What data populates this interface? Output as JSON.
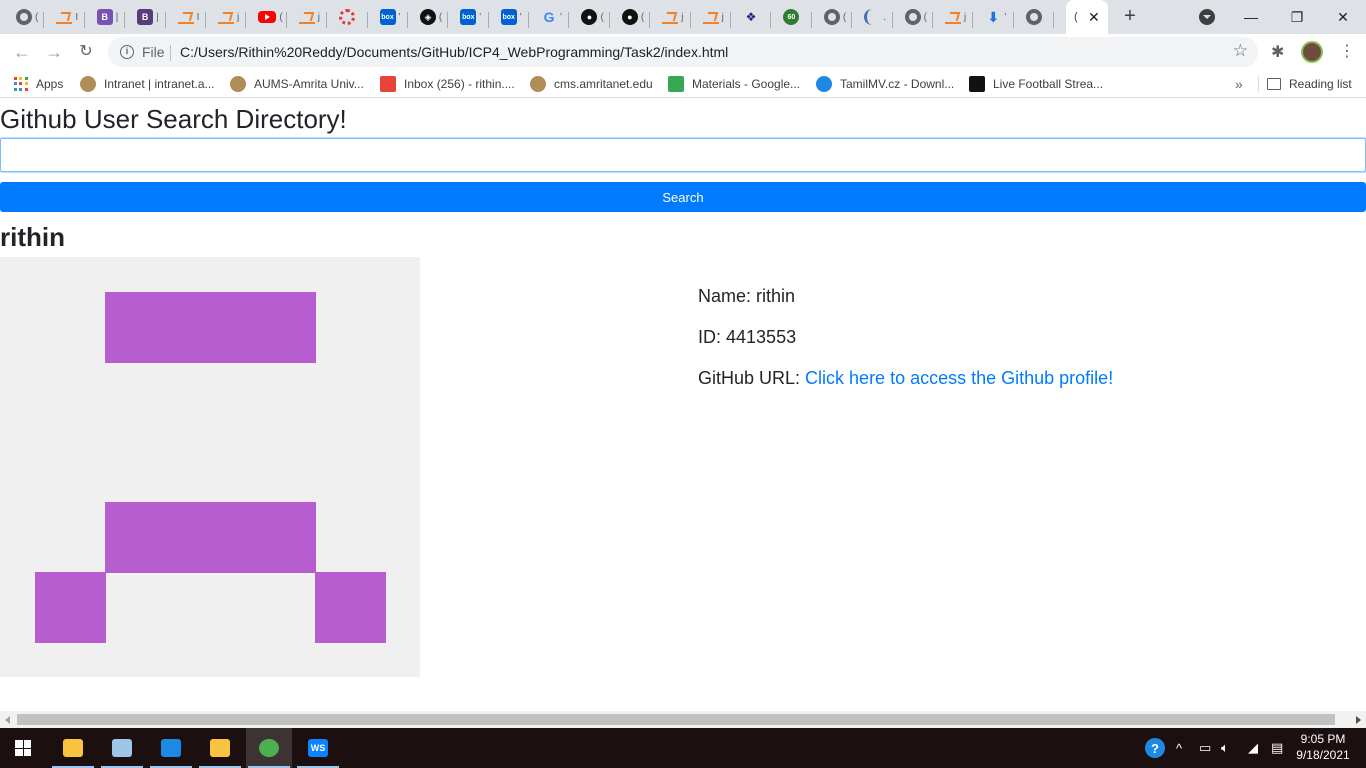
{
  "browser": {
    "tabs": [
      {
        "icon": "globe-icon",
        "class": "globe",
        "letter": "("
      },
      {
        "icon": "stackoverflow-icon",
        "class": "so",
        "letter": "I"
      },
      {
        "icon": "bootstrap-icon",
        "class": "b",
        "glyph": "B",
        "letter": "|"
      },
      {
        "icon": "bootstrap-icon",
        "class": "bdark",
        "glyph": "B",
        "letter": "|"
      },
      {
        "icon": "stackoverflow-icon",
        "class": "so",
        "letter": "I"
      },
      {
        "icon": "stackoverflow-icon",
        "class": "so",
        "letter": "j"
      },
      {
        "icon": "youtube-icon",
        "class": "yt",
        "letter": "("
      },
      {
        "icon": "stackoverflow-icon",
        "class": "so",
        "letter": "j"
      },
      {
        "icon": "ring-icon",
        "class": "ring",
        "letter": ""
      },
      {
        "icon": "box-icon",
        "class": "box",
        "glyph": "box",
        "letter": "'"
      },
      {
        "icon": "codepen-icon",
        "class": "cp",
        "glyph": "◈",
        "letter": "("
      },
      {
        "icon": "box-icon",
        "class": "box",
        "glyph": "box",
        "letter": "'"
      },
      {
        "icon": "box-icon",
        "class": "box",
        "glyph": "box",
        "letter": "'"
      },
      {
        "icon": "google-icon",
        "class": "g",
        "glyph": "G",
        "letter": "'"
      },
      {
        "icon": "github-icon",
        "class": "gh",
        "glyph": "●",
        "letter": "("
      },
      {
        "icon": "github-icon",
        "class": "gh",
        "glyph": "●",
        "letter": "("
      },
      {
        "icon": "stackoverflow-icon",
        "class": "so",
        "letter": "j"
      },
      {
        "icon": "stackoverflow-icon",
        "class": "so",
        "letter": "j"
      },
      {
        "icon": "ms-icon",
        "class": "ms",
        "glyph": "❖",
        "letter": ""
      },
      {
        "icon": "sixty-icon",
        "class": "sixty",
        "glyph": "60",
        "letter": ""
      },
      {
        "icon": "globe-icon",
        "class": "globe",
        "letter": "("
      },
      {
        "icon": "moon-icon",
        "class": "moon",
        "letter": "."
      },
      {
        "icon": "globe-icon",
        "class": "globe",
        "letter": "("
      },
      {
        "icon": "stackoverflow-icon",
        "class": "so",
        "letter": "j"
      },
      {
        "icon": "download-icon",
        "class": "dl",
        "glyph": "⬇",
        "letter": "'"
      },
      {
        "icon": "globe-icon",
        "class": "globe",
        "letter": ""
      }
    ],
    "active_tab_title": "(",
    "new_tab_label": "+",
    "window_controls": {
      "minimize": "—",
      "restore": "❐",
      "close": "✕"
    },
    "url_scheme_label": "File",
    "url": "C:/Users/Rithin%20Reddy/Documents/GitHub/ICP4_WebProgramming/Task2/index.html",
    "nav": {
      "back": "←",
      "forward": "→",
      "reload": "↻"
    },
    "bookmarks": [
      {
        "label": "Apps",
        "icon": "apps-icon"
      },
      {
        "label": "Intranet | intranet.a...",
        "icon": "amrita-icon"
      },
      {
        "label": "AUMS-Amrita Univ...",
        "icon": "amrita-icon"
      },
      {
        "label": "Inbox (256) - rithin....",
        "icon": "gmail-icon"
      },
      {
        "label": "cms.amritanet.edu",
        "icon": "amrita-icon"
      },
      {
        "label": "Materials - Google...",
        "icon": "drive-icon"
      },
      {
        "label": "TamilMV.cz - Downl...",
        "icon": "play-icon"
      },
      {
        "label": "Live Football Strea...",
        "icon": "football-icon"
      }
    ],
    "bookmarks_more": "»",
    "reading_list_label": "Reading list"
  },
  "page": {
    "title": "Github User Search Directory!",
    "search": {
      "value": "",
      "placeholder": ""
    },
    "search_button_label": "Search",
    "user": {
      "login": "rithin",
      "name_label": "Name: ",
      "name": "rithin",
      "id_label": "ID: ",
      "id": "4413553",
      "url_label": "GitHub URL: ",
      "url_link_text": "Click here to access the Github profile!"
    },
    "identicon_color": "#b65ed0"
  },
  "colors": {
    "primary": "#007bff",
    "identicon_bg": "#f0f0f0",
    "taskbar_bg": "#1b0f0f"
  },
  "taskbar": {
    "apps": [
      {
        "name": "file-explorer-icon"
      },
      {
        "name": "app-icon"
      },
      {
        "name": "sync-icon"
      },
      {
        "name": "folder-icon"
      },
      {
        "name": "chrome-icon",
        "active": true
      },
      {
        "name": "webstorm-icon",
        "glyph": "WS"
      }
    ],
    "time": "9:05 PM",
    "date": "9/18/2021"
  }
}
